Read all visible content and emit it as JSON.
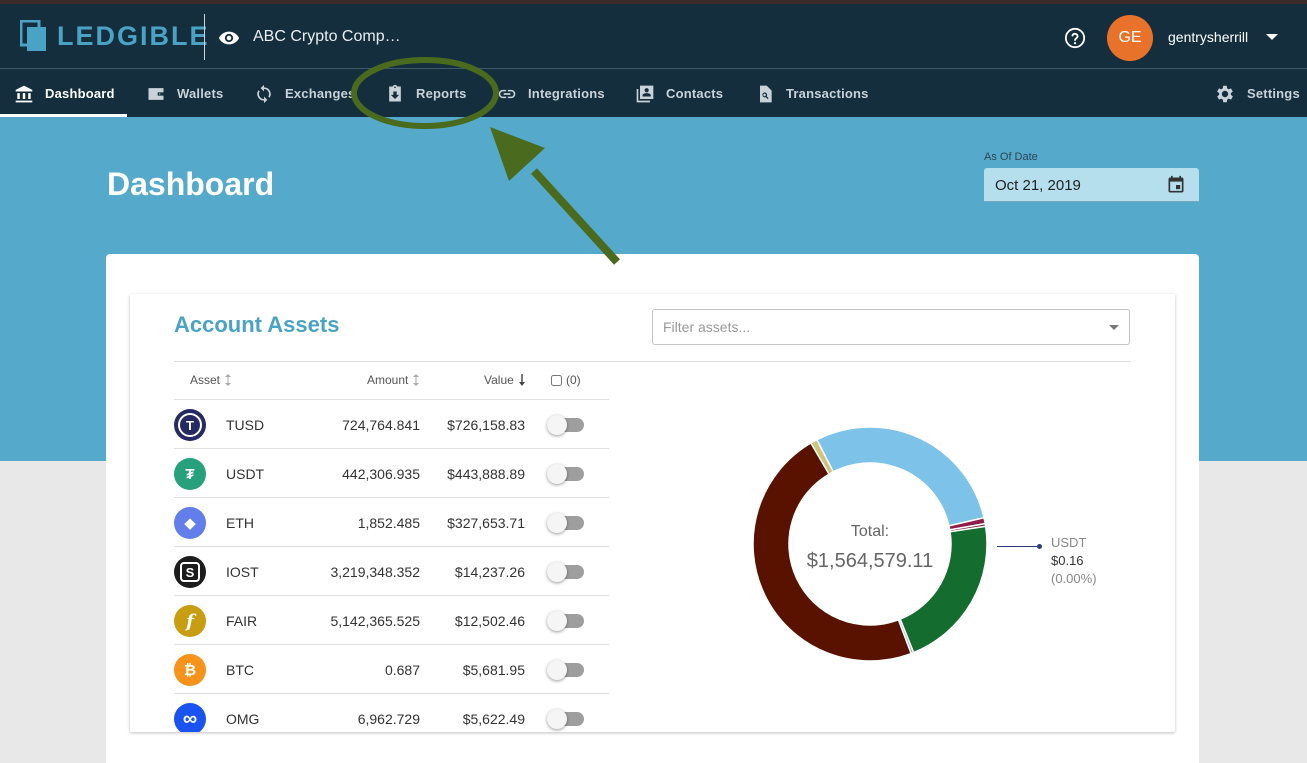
{
  "brand": {
    "name": "LEDGIBLE"
  },
  "header": {
    "company": "ABC Crypto Comp…",
    "avatar_initials": "GE",
    "username": "gentrysherrill"
  },
  "nav": {
    "items": [
      {
        "label": "Dashboard",
        "icon": "bank-icon",
        "active": true
      },
      {
        "label": "Wallets",
        "icon": "wallet-icon"
      },
      {
        "label": "Exchanges",
        "icon": "sync-icon"
      },
      {
        "label": "Reports",
        "icon": "report-download-icon"
      },
      {
        "label": "Integrations",
        "icon": "link-icon"
      },
      {
        "label": "Contacts",
        "icon": "contacts-icon"
      },
      {
        "label": "Transactions",
        "icon": "transaction-search-icon"
      }
    ],
    "settings_label": "Settings"
  },
  "page": {
    "title": "Dashboard",
    "as_of_label": "As Of Date",
    "as_of_value": "Oct 21, 2019"
  },
  "assets": {
    "title": "Account Assets",
    "filter_placeholder": "Filter assets...",
    "columns": {
      "asset": "Asset",
      "amount": "Amount",
      "value": "Value",
      "select_count": "(0)"
    },
    "rows": [
      {
        "symbol": "TUSD",
        "amount": "724,764.841",
        "value": "$726,158.83",
        "color": "#262a62",
        "glyph": "T"
      },
      {
        "symbol": "USDT",
        "amount": "442,306.935",
        "value": "$443,888.89",
        "color": "#26a17b",
        "glyph": "₮"
      },
      {
        "symbol": "ETH",
        "amount": "1,852.485",
        "value": "$327,653.71",
        "color": "#627eea",
        "glyph": "◆"
      },
      {
        "symbol": "IOST",
        "amount": "3,219,348.352",
        "value": "$14,237.26",
        "color": "#1c1c1c",
        "glyph": "S"
      },
      {
        "symbol": "FAIR",
        "amount": "5,142,365.525",
        "value": "$12,502.46",
        "color": "#c99d12",
        "glyph": "f"
      },
      {
        "symbol": "BTC",
        "amount": "0.687",
        "value": "$5,681.95",
        "color": "#f7931a",
        "glyph": "₿"
      },
      {
        "symbol": "OMG",
        "amount": "6,962.729",
        "value": "$5,622.49",
        "color": "#1a53f0",
        "glyph": "∞"
      }
    ]
  },
  "summary": {
    "total_label": "Total:",
    "total_value": "$1,564,579.11",
    "tooltip_name": "USDT",
    "tooltip_value": "$0.16",
    "tooltip_pct": "(0.00%)"
  },
  "chart_data": {
    "type": "pie",
    "slices": [
      {
        "label": "TUSD",
        "value": 726158.83,
        "color": "#5a1200"
      },
      {
        "label": "USDT",
        "value": 443888.89,
        "color": "#7dc2e8"
      },
      {
        "label": "ETH",
        "value": 327653.71,
        "color": "#146d2e"
      },
      {
        "label": "IOST",
        "value": 14237.26,
        "color": "#d0c37a"
      },
      {
        "label": "FAIR",
        "value": 12502.46,
        "color": "#8e1d4a"
      },
      {
        "label": "BTC",
        "value": 5681.95,
        "color": "#7a2b3a"
      },
      {
        "label": "OMG",
        "value": 5622.49,
        "color": "#9fb7c0"
      }
    ],
    "total": "$1,564,579.11"
  },
  "colors": {
    "header": "#152e3d",
    "hero": "#55aacb",
    "accent": "#4aa3c4",
    "avatar": "#e8722a",
    "annotation": "#4a6b1e"
  }
}
